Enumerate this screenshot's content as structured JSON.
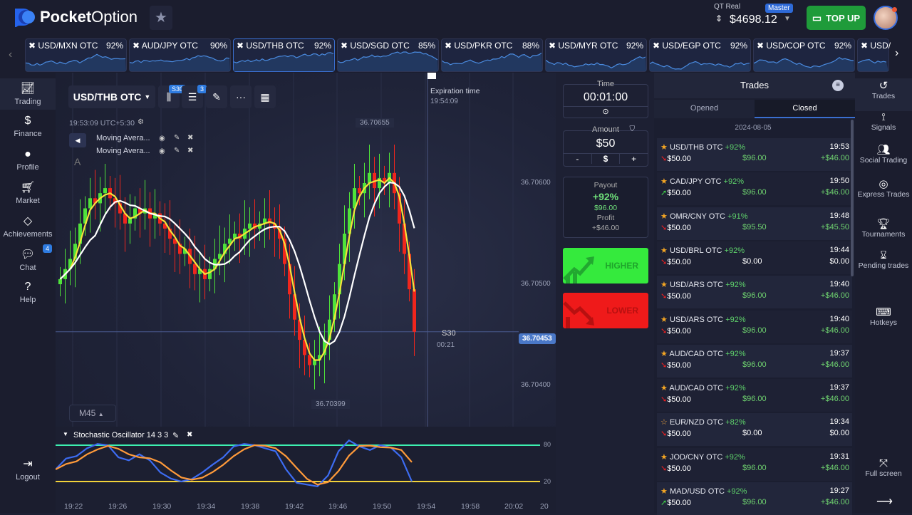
{
  "header": {
    "brand_bold": "Pocket",
    "brand_light": "Option",
    "account_type": "QT Real",
    "account_badge": "Master",
    "balance": "$4698.12",
    "topup_label": "TOP UP"
  },
  "tickers": [
    {
      "name": "USD/MXN OTC",
      "pct": "92%"
    },
    {
      "name": "AUD/JPY OTC",
      "pct": "90%"
    },
    {
      "name": "USD/THB OTC",
      "pct": "92%",
      "active": true
    },
    {
      "name": "USD/SGD OTC",
      "pct": "85%"
    },
    {
      "name": "USD/PKR OTC",
      "pct": "88%"
    },
    {
      "name": "USD/MYR OTC",
      "pct": "92%"
    },
    {
      "name": "USD/EGP OTC",
      "pct": "92%"
    },
    {
      "name": "USD/COP OTC",
      "pct": "92%"
    },
    {
      "name": "USD/",
      "pct": ""
    }
  ],
  "left_nav": [
    {
      "label": "Trading",
      "icon": "chart-line-icon"
    },
    {
      "label": "Finance",
      "icon": "dollar-icon"
    },
    {
      "label": "Profile",
      "icon": "user-icon"
    },
    {
      "label": "Market",
      "icon": "cart-icon"
    },
    {
      "label": "Achievements",
      "icon": "diamond-icon"
    },
    {
      "label": "Chat",
      "icon": "chat-icon",
      "badge": "4"
    },
    {
      "label": "Help",
      "icon": "help-icon"
    },
    {
      "label": "Logout",
      "icon": "logout-icon"
    }
  ],
  "chart": {
    "asset": "USD/THB OTC",
    "candle_badge": "S30",
    "indicator_badge": "3",
    "clock": "19:53:09 UTC+5:30",
    "indicators": [
      "Moving Avera...",
      "Moving Avera..."
    ],
    "draw_letter": "A",
    "timeframe": "M45",
    "expiration_label": "Expiration time",
    "expiration_time": "19:54:09",
    "high_label": "36.70655",
    "low_label": "36.70399",
    "current_price": "36.70453",
    "candle_period": "S30",
    "candle_timer": "00:21",
    "price_ticks": [
      "36.70600",
      "36.70500",
      "36.70400"
    ],
    "time_ticks": [
      "19:22",
      "19:26",
      "19:30",
      "19:34",
      "19:38",
      "19:42",
      "19:46",
      "19:50",
      "19:54",
      "19:58",
      "20:02",
      "20"
    ],
    "closes": [
      36.70505,
      36.70515,
      36.70525,
      36.7054,
      36.7056,
      36.70575,
      36.70585,
      36.7058,
      36.7059,
      36.70595,
      36.70585,
      36.7058,
      36.7057,
      36.7056,
      36.70565,
      36.70575,
      36.7057,
      36.70575,
      36.70565,
      36.7057,
      36.7056,
      36.70555,
      36.70545,
      36.7054,
      36.7053,
      36.70535,
      36.7052,
      36.7051,
      36.70515,
      36.70505,
      36.70515,
      36.70525,
      36.7053,
      36.7054,
      36.70545,
      36.7055,
      36.70545,
      36.70555,
      36.7056,
      36.70555,
      36.7056,
      36.70565,
      36.7056,
      36.70555,
      36.70545,
      36.7052,
      36.7049,
      36.70465,
      36.70445,
      36.7043,
      36.7042,
      36.70425,
      36.7043,
      36.70445,
      36.70465,
      36.7049,
      36.7052,
      36.7055,
      36.70575,
      36.70595,
      36.7059,
      36.706,
      36.7061,
      36.70595,
      36.70605,
      36.706,
      36.7061,
      36.7059,
      36.7056,
      36.7053,
      36.70495,
      36.70453
    ],
    "colors": {
      "up": "#4fe33a",
      "down": "#f0261d",
      "ma_fast": "#f5e23a",
      "ma_slow": "#ffffff"
    }
  },
  "stochastic": {
    "title": "Stochastic Oscillator",
    "params": "14 3 3",
    "levels": [
      "80",
      "20"
    ],
    "k": [
      40,
      58,
      62,
      75,
      82,
      80,
      60,
      55,
      65,
      55,
      35,
      25,
      20,
      24,
      35,
      48,
      60,
      78,
      82,
      80,
      75,
      70,
      40,
      18,
      15,
      12,
      30,
      70,
      88,
      78,
      72,
      80,
      76,
      60,
      20
    ],
    "colors": {
      "k": "#3d6cf2",
      "d": "#ff9a3a",
      "upper": "#3df0b0",
      "lower": "#f2d23a"
    }
  },
  "trade_panel": {
    "time_label": "Time",
    "time_value": "00:01:00",
    "amount_label": "Amount",
    "amount_value": "$50",
    "minus": "-",
    "currency": "$",
    "plus": "+",
    "payout_label": "Payout",
    "payout_pct": "+92%",
    "payout_value": "$96.00",
    "profit_label": "Profit",
    "profit_value": "+$46.00",
    "higher_label": "HIGHER",
    "lower_label": "LOWER"
  },
  "trades": {
    "title": "Trades",
    "tab_opened": "Opened",
    "tab_closed": "Closed",
    "date": "2024-08-05",
    "items": [
      {
        "asset": "USD/THB OTC",
        "pct": "+92%",
        "time": "19:53",
        "stake": "$50.00",
        "payout": "$96.00",
        "profit": "+$46.00",
        "dir": "down"
      },
      {
        "asset": "CAD/JPY OTC",
        "pct": "+92%",
        "time": "19:50",
        "stake": "$50.00",
        "payout": "$96.00",
        "profit": "+$46.00",
        "dir": "up"
      },
      {
        "asset": "OMR/CNY OTC",
        "pct": "+91%",
        "time": "19:48",
        "stake": "$50.00",
        "payout": "$95.50",
        "profit": "+$45.50",
        "dir": "down"
      },
      {
        "asset": "USD/BRL OTC",
        "pct": "+92%",
        "time": "19:44",
        "stake": "$50.00",
        "payout": "$0.00",
        "profit": "$0.00",
        "dir": "down"
      },
      {
        "asset": "USD/ARS OTC",
        "pct": "+92%",
        "time": "19:40",
        "stake": "$50.00",
        "payout": "$96.00",
        "profit": "+$46.00",
        "dir": "down"
      },
      {
        "asset": "USD/ARS OTC",
        "pct": "+92%",
        "time": "19:40",
        "stake": "$50.00",
        "payout": "$96.00",
        "profit": "+$46.00",
        "dir": "down"
      },
      {
        "asset": "AUD/CAD OTC",
        "pct": "+92%",
        "time": "19:37",
        "stake": "$50.00",
        "payout": "$96.00",
        "profit": "+$46.00",
        "dir": "down"
      },
      {
        "asset": "AUD/CAD OTC",
        "pct": "+92%",
        "time": "19:37",
        "stake": "$50.00",
        "payout": "$96.00",
        "profit": "+$46.00",
        "dir": "down"
      },
      {
        "asset": "EUR/NZD OTC",
        "pct": "+82%",
        "time": "19:34",
        "stake": "$50.00",
        "payout": "$0.00",
        "profit": "$0.00",
        "dir": "down",
        "star": "outline"
      },
      {
        "asset": "JOD/CNY OTC",
        "pct": "+92%",
        "time": "19:31",
        "stake": "$50.00",
        "payout": "$96.00",
        "profit": "+$46.00",
        "dir": "down"
      },
      {
        "asset": "MAD/USD OTC",
        "pct": "+92%",
        "time": "19:27",
        "stake": "$50.00",
        "payout": "$96.00",
        "profit": "+$46.00",
        "dir": "up"
      }
    ]
  },
  "right_nav": [
    {
      "label": "Trades",
      "icon": "history-icon"
    },
    {
      "label": "Signals",
      "icon": "signal-icon"
    },
    {
      "label": "Social Trading",
      "icon": "users-icon"
    },
    {
      "label": "Express Trades",
      "icon": "target-icon"
    },
    {
      "label": "Tournaments",
      "icon": "trophy-icon"
    },
    {
      "label": "Pending trades",
      "icon": "hourglass-icon"
    },
    {
      "label": "Hotkeys",
      "icon": "keyboard-icon"
    },
    {
      "label": "Full screen",
      "icon": "fullscreen-icon"
    }
  ]
}
